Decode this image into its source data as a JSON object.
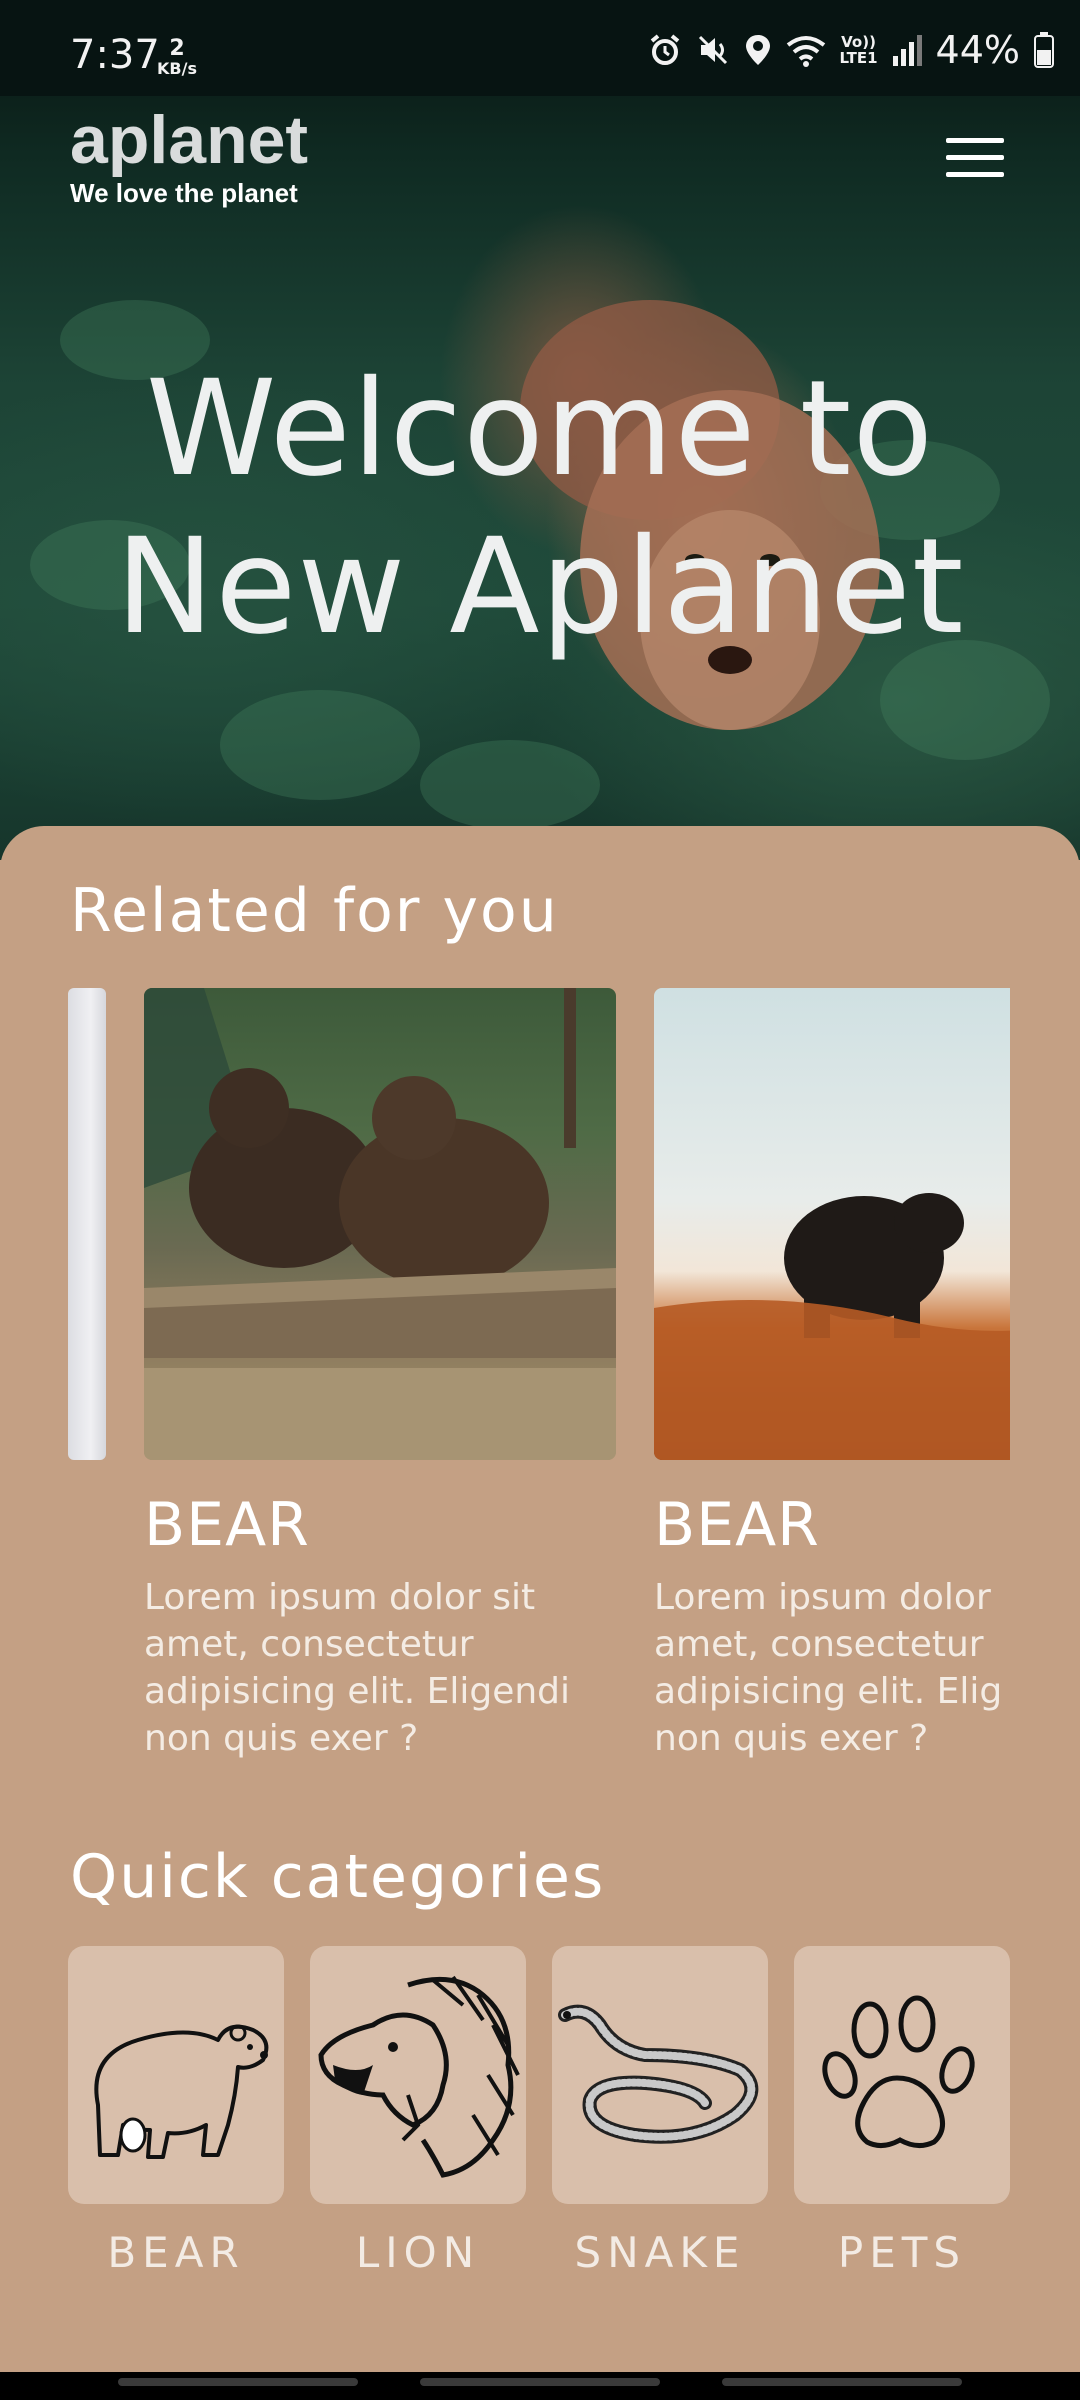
{
  "status_bar": {
    "time": "7:37",
    "speed_value": "2",
    "speed_unit": "KB/s",
    "volte": "Vo))",
    "lte": "LTE1",
    "battery": "44%"
  },
  "header": {
    "brand": "aplanet",
    "tagline": "We love the planet"
  },
  "hero": {
    "title_line1": "Welcome to",
    "title_line2": "New Aplanet"
  },
  "related": {
    "title": "Related for you",
    "cards": [
      {
        "heading": "BEAR",
        "lines": [
          "Lorem ipsum dolor sit",
          "amet, consectetur",
          "adipisicing elit. Eligendi",
          "non quis exer ?"
        ]
      },
      {
        "heading": "BEAR",
        "lines": [
          "Lorem ipsum dolor",
          "amet, consectetur",
          "adipisicing elit. Elig",
          "non quis exer ?"
        ]
      }
    ]
  },
  "categories": {
    "title": "Quick categories",
    "items": [
      {
        "label": "BEAR",
        "icon": "bear-icon"
      },
      {
        "label": "LION",
        "icon": "lion-icon"
      },
      {
        "label": "SNAKE",
        "icon": "snake-icon"
      },
      {
        "label": "PETS",
        "icon": "paw-icon"
      }
    ]
  },
  "colors": {
    "sheet": "#c4a084",
    "tile": "#d9bfab",
    "hero_dark": "#0f2a22"
  }
}
